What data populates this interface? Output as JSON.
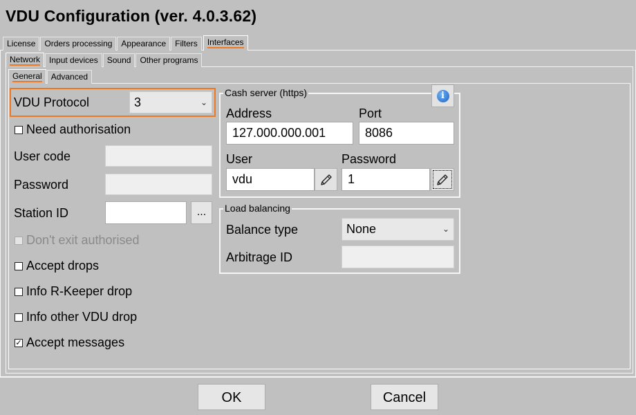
{
  "window": {
    "title": "VDU Configuration (ver. 4.0.3.62)"
  },
  "tabs_top": [
    "License",
    "Orders processing",
    "Appearance",
    "Filters",
    "Interfaces"
  ],
  "tabs_mid": [
    "Network",
    "Input devices",
    "Sound",
    "Other programs"
  ],
  "tabs_inner": [
    "General",
    "Advanced"
  ],
  "left": {
    "vdu_protocol_label": "VDU Protocol",
    "vdu_protocol_value": "3",
    "need_auth_label": "Need authorisation",
    "need_auth_checked": false,
    "user_code_label": "User code",
    "user_code_value": "",
    "password_label": "Password",
    "password_value": "",
    "station_id_label": "Station ID",
    "station_id_value": "",
    "station_browse": "...",
    "dont_exit_label": "Don't exit authorised",
    "dont_exit_checked": false,
    "accept_drops_label": "Accept drops",
    "accept_drops_checked": false,
    "info_rkeeper_label": "Info R-Keeper drop",
    "info_rkeeper_checked": false,
    "info_other_label": "Info other VDU drop",
    "info_other_checked": false,
    "accept_messages_label": "Accept messages",
    "accept_messages_checked": true
  },
  "cash_server": {
    "group_title": "Cash server (https)",
    "address_label": "Address",
    "address_value": "127.000.000.001",
    "port_label": "Port",
    "port_value": "8086",
    "user_label": "User",
    "user_value": "vdu",
    "password_label": "Password",
    "password_value": "1",
    "info_icon": "i"
  },
  "load_balancing": {
    "group_title": "Load balancing",
    "balance_type_label": "Balance type",
    "balance_type_value": "None",
    "arbitrage_label": "Arbitrage ID",
    "arbitrage_value": ""
  },
  "footer": {
    "ok_label": "OK",
    "cancel_label": "Cancel"
  },
  "colors": {
    "accent": "#f07820",
    "background": "#c0c0c0"
  }
}
